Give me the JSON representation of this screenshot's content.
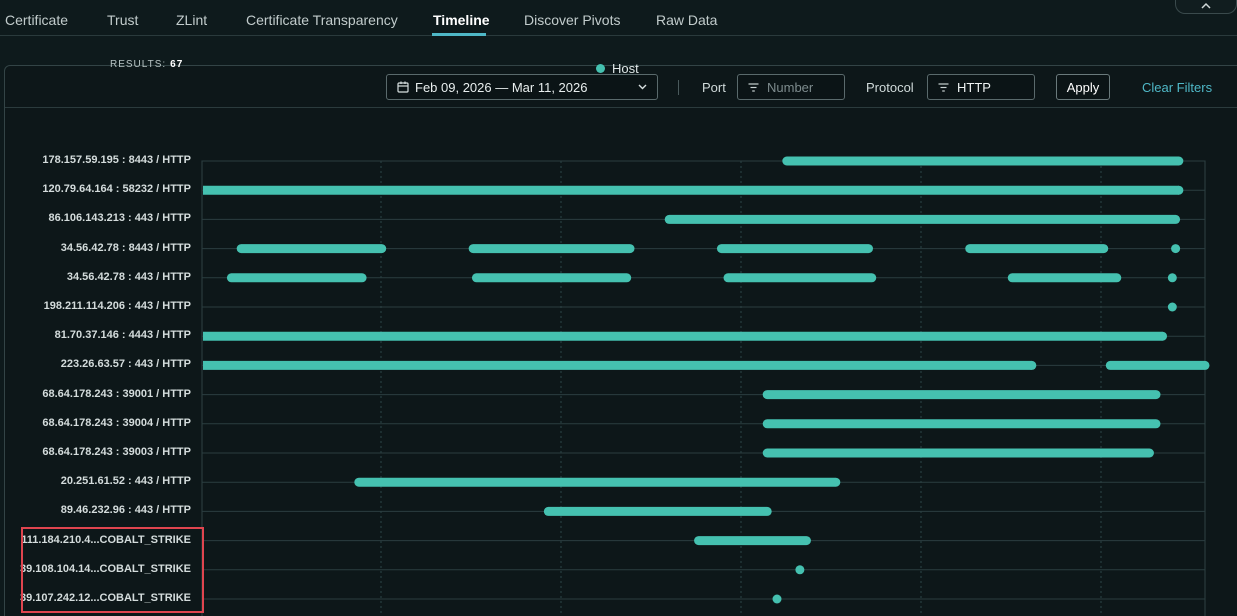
{
  "tabs": [
    {
      "label": "Certificate",
      "active": false
    },
    {
      "label": "Trust",
      "active": false
    },
    {
      "label": "ZLint",
      "active": false
    },
    {
      "label": "Certificate Transparency",
      "active": false
    },
    {
      "label": "Timeline",
      "active": true
    },
    {
      "label": "Discover Pivots",
      "active": false
    },
    {
      "label": "Raw Data",
      "active": false
    }
  ],
  "filters": {
    "date_range": "Feb 09, 2026 — Mar 11, 2026",
    "port_label": "Port",
    "port_placeholder": "Number",
    "protocol_label": "Protocol",
    "protocol_value": "HTTP",
    "apply_label": "Apply",
    "clear_label": "Clear Filters"
  },
  "results": {
    "label": "RESULTS:",
    "count": "67"
  },
  "legend": {
    "label": "Host",
    "color": "#45c1b0"
  },
  "colors": {
    "accent": "#4fb8c7",
    "bar": "#45c1b0",
    "highlight": "#e0454f"
  },
  "chart_data": {
    "type": "timeline",
    "x_range": [
      "Feb 09, 2026",
      "Mar 11, 2026"
    ],
    "grid": true,
    "rows": [
      {
        "label": "178.157.59.195 : 8443 / HTTP",
        "segments": [
          [
            17.9,
            29.9
          ]
        ]
      },
      {
        "label": "120.79.64.164 : 58232 / HTTP",
        "segments": [
          [
            0,
            29.9
          ]
        ]
      },
      {
        "label": "86.106.143.213 : 443 / HTTP",
        "segments": [
          [
            14.3,
            29.8
          ]
        ]
      },
      {
        "label": "34.56.42.78 : 8443 / HTTP",
        "segments": [
          [
            1.2,
            5.5
          ],
          [
            8.3,
            13.1
          ],
          [
            15.9,
            20.4
          ],
          [
            23.5,
            27.6
          ],
          [
            29.8,
            29.8
          ]
        ]
      },
      {
        "label": "34.56.42.78 : 443 / HTTP",
        "segments": [
          [
            0.9,
            4.9
          ],
          [
            8.4,
            13.0
          ],
          [
            16.1,
            20.5
          ],
          [
            24.8,
            28.0
          ],
          [
            29.7,
            29.7
          ]
        ]
      },
      {
        "label": "198.211.114.206 : 443 / HTTP",
        "segments": [
          [
            29.7,
            29.7
          ]
        ]
      },
      {
        "label": "81.70.37.146 : 4443 / HTTP",
        "segments": [
          [
            0,
            29.4
          ]
        ]
      },
      {
        "label": "223.26.63.57 : 443 / HTTP",
        "segments": [
          [
            0,
            25.4
          ],
          [
            27.8,
            30.7
          ]
        ]
      },
      {
        "label": "68.64.178.243 : 39001 / HTTP",
        "segments": [
          [
            17.3,
            29.2
          ]
        ]
      },
      {
        "label": "68.64.178.243 : 39004 / HTTP",
        "segments": [
          [
            17.3,
            29.2
          ]
        ]
      },
      {
        "label": "68.64.178.243 : 39003 / HTTP",
        "segments": [
          [
            17.3,
            29.0
          ]
        ]
      },
      {
        "label": "20.251.61.52 : 443 / HTTP",
        "segments": [
          [
            4.8,
            19.4
          ]
        ]
      },
      {
        "label": "89.46.232.96 : 443 / HTTP",
        "segments": [
          [
            10.6,
            17.3
          ]
        ]
      },
      {
        "label": "111.184.210.4...COBALT_STRIKE",
        "segments": [
          [
            15.2,
            18.5
          ]
        ]
      },
      {
        "label": "39.108.104.14...COBALT_STRIKE",
        "segments": [
          [
            18.3,
            18.3
          ]
        ]
      },
      {
        "label": "39.107.242.12...COBALT_STRIKE",
        "segments": [
          [
            17.6,
            17.6
          ]
        ]
      }
    ]
  }
}
